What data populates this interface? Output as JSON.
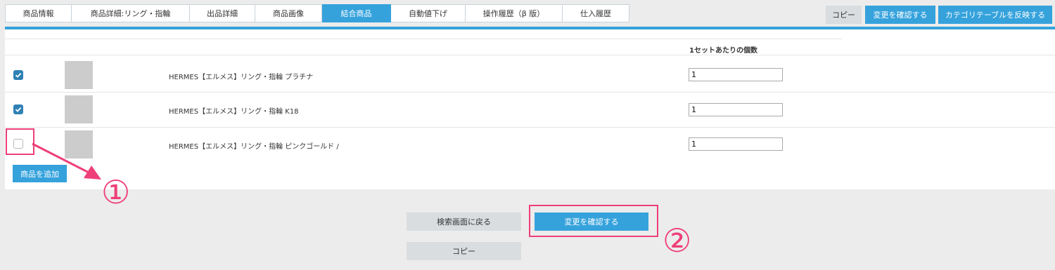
{
  "tabs": [
    {
      "label": "商品情報",
      "active": false
    },
    {
      "label": "商品詳細:リング・指輪",
      "active": false
    },
    {
      "label": "出品詳細",
      "active": false
    },
    {
      "label": "商品画像",
      "active": false
    },
    {
      "label": "結合商品",
      "active": true
    },
    {
      "label": "自動値下げ",
      "active": false
    },
    {
      "label": "操作履歴（β 版）",
      "active": false
    },
    {
      "label": "仕入履歴",
      "active": false
    }
  ],
  "toolbar": {
    "copy_label": "コピー",
    "confirm_label": "変更を確認する",
    "reflect_label": "カテゴリテーブルを反映する"
  },
  "table": {
    "qty_header": "1セットあたりの個数",
    "rows": [
      {
        "checked": true,
        "name": "HERMES【エルメス】リング・指輪 プラチナ",
        "qty": "1"
      },
      {
        "checked": true,
        "name": "HERMES【エルメス】リング・指輪 K18",
        "qty": "1"
      },
      {
        "checked": false,
        "name": "HERMES【エルメス】リング・指輪 ピンクゴールド /",
        "qty": "1"
      }
    ]
  },
  "add_product_label": "商品を追加",
  "bottom": {
    "back_label": "検索画面に戻る",
    "confirm_label": "変更を確認する",
    "copy_label": "コピー"
  },
  "annotations": {
    "step1": "①",
    "step2": "②",
    "color": "#ee3f78"
  },
  "colors": {
    "accent": "#35a2dc",
    "checkbox": "#2f81b4"
  }
}
